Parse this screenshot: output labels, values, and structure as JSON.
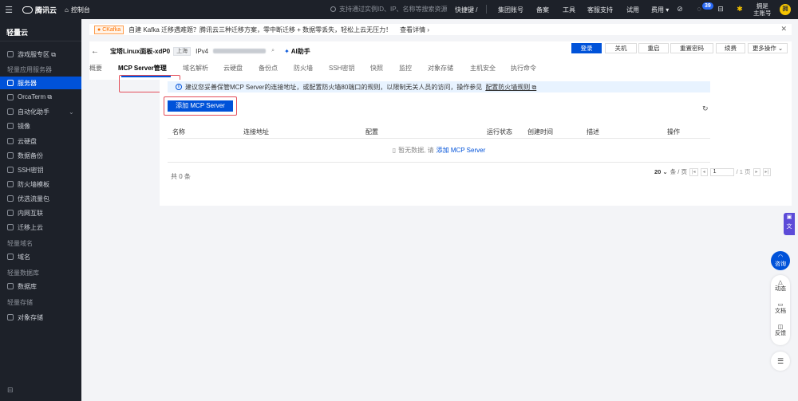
{
  "topbar": {
    "brand": "腾讯云",
    "console": "控制台",
    "search_placeholder": "支持通过实例ID、IP、名称等搜索资源",
    "shortcut": "快捷键 /",
    "nav": [
      "集团账号",
      "备案",
      "工具",
      "客服支持",
      "试用",
      "费用"
    ],
    "notification_count": "39",
    "user_line1": "拥是",
    "user_line2": "主账号",
    "avatar_text": "拥"
  },
  "sidebar": {
    "title": "轻量云",
    "items": [
      {
        "label": "游戏服专区 ⧉"
      },
      {
        "group": "轻量应用服务器"
      },
      {
        "label": "服务器",
        "active": true
      },
      {
        "label": "OrcaTerm ⧉"
      },
      {
        "label": "自动化助手"
      },
      {
        "label": "镜像"
      },
      {
        "label": "云硬盘"
      },
      {
        "label": "数据备份"
      },
      {
        "label": "SSH密钥"
      },
      {
        "label": "防火墙模板"
      },
      {
        "label": "优选流量包"
      },
      {
        "label": "内网互联"
      },
      {
        "label": "迁移上云"
      },
      {
        "group": "轻量域名"
      },
      {
        "label": "域名"
      },
      {
        "group": "轻量数据库"
      },
      {
        "label": "数据库"
      },
      {
        "group": "轻量存储"
      },
      {
        "label": "对象存储"
      }
    ],
    "collapse_icon": "⊟"
  },
  "notice": {
    "tag": "CKafka",
    "text": "自建 Kafka 迁移遇难题？腾讯云三种迁移方案，零中断迁移 + 数据零丢失，轻松上云无压力！",
    "link": "查看详情 ›"
  },
  "server": {
    "name": "宝塔Linux面板-xdP0",
    "status": "上海",
    "ip_label": "IPv4",
    "ip_value": "",
    "ai_label": "AI助手"
  },
  "actions": {
    "login": "登录",
    "shutdown": "关机",
    "restart": "重启",
    "reset_password": "重置密码",
    "renew": "续费",
    "more": "更多操作 ⌄"
  },
  "tabs": [
    "概要",
    "MCP Server管理",
    "域名解析",
    "云硬盘",
    "备份点",
    "防火墙",
    "SSH密钥",
    "快照",
    "监控",
    "对象存储",
    "主机安全",
    "执行命令"
  ],
  "mcp": {
    "info_text": "建议您妥善保管MCP Server的连接地址，或配置防火墙80端口的规则，以限制无关人员的访问，操作参见",
    "info_link": "配置防火墙规则 ⧉",
    "add_button": "添加 MCP Server",
    "columns": [
      "名称",
      "连接地址",
      "配置",
      "运行状态",
      "创建时间",
      "描述",
      "操作"
    ],
    "empty_text": "暂无数据, 请",
    "empty_link": "添加 MCP Server",
    "total": "共 0 条",
    "page_size": "20 ⌄",
    "page_size_unit": "条 / 页",
    "page_current": "1",
    "page_total": "/ 1 页"
  },
  "right_float": {
    "consult": "咨询",
    "dynamic": "动态",
    "docs": "文档",
    "feedback": "反馈"
  }
}
